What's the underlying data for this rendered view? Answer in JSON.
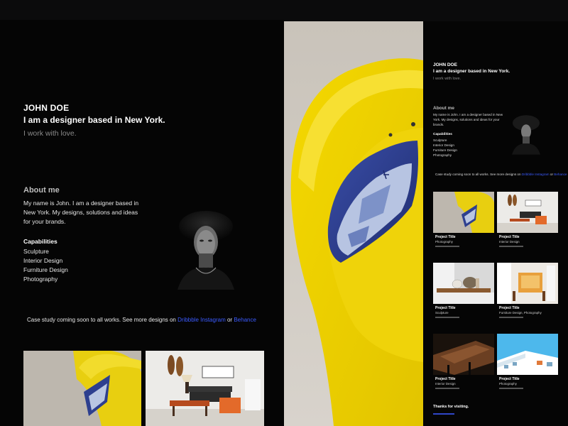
{
  "profile": {
    "name": "JOHN DOE",
    "tagline": "I am a designer based in New York.",
    "subtitle": "I work with love.",
    "about_heading": "About me",
    "bio": "My name is John. I am a designer based in New York. My designs, solutions and ideas for your brands.",
    "capabilities_heading": "Capabilities",
    "capabilities": [
      "Sculpture",
      "Interior Design",
      "Furniture Design",
      "Photography"
    ]
  },
  "case_study": {
    "text": "Case study coming soon to all works. See more designs on",
    "link_dribbble": "Dribbble",
    "link_instagram": "Instagram",
    "or": "or",
    "link_behance": "Behance"
  },
  "projects": [
    {
      "title": "Project Title",
      "category": "Photography"
    },
    {
      "title": "Project Title",
      "category": "Interior Design"
    },
    {
      "title": "Project Title",
      "category": "Sculpture"
    },
    {
      "title": "Project Title",
      "category": "Furniture Design, Photography"
    },
    {
      "title": "Project Title",
      "category": "Interior Design"
    },
    {
      "title": "Project Title",
      "category": "Photography"
    }
  ],
  "footer": {
    "thanks": "Thanks for visiting."
  },
  "colors": {
    "background": "#050505",
    "link": "#3b5bff",
    "sofa_yellow": "#f0d400",
    "pillow_blue": "#2d3f8f"
  },
  "icons": {
    "portrait": "portrait-photo",
    "sofa": "yellow-sofa-photo"
  }
}
